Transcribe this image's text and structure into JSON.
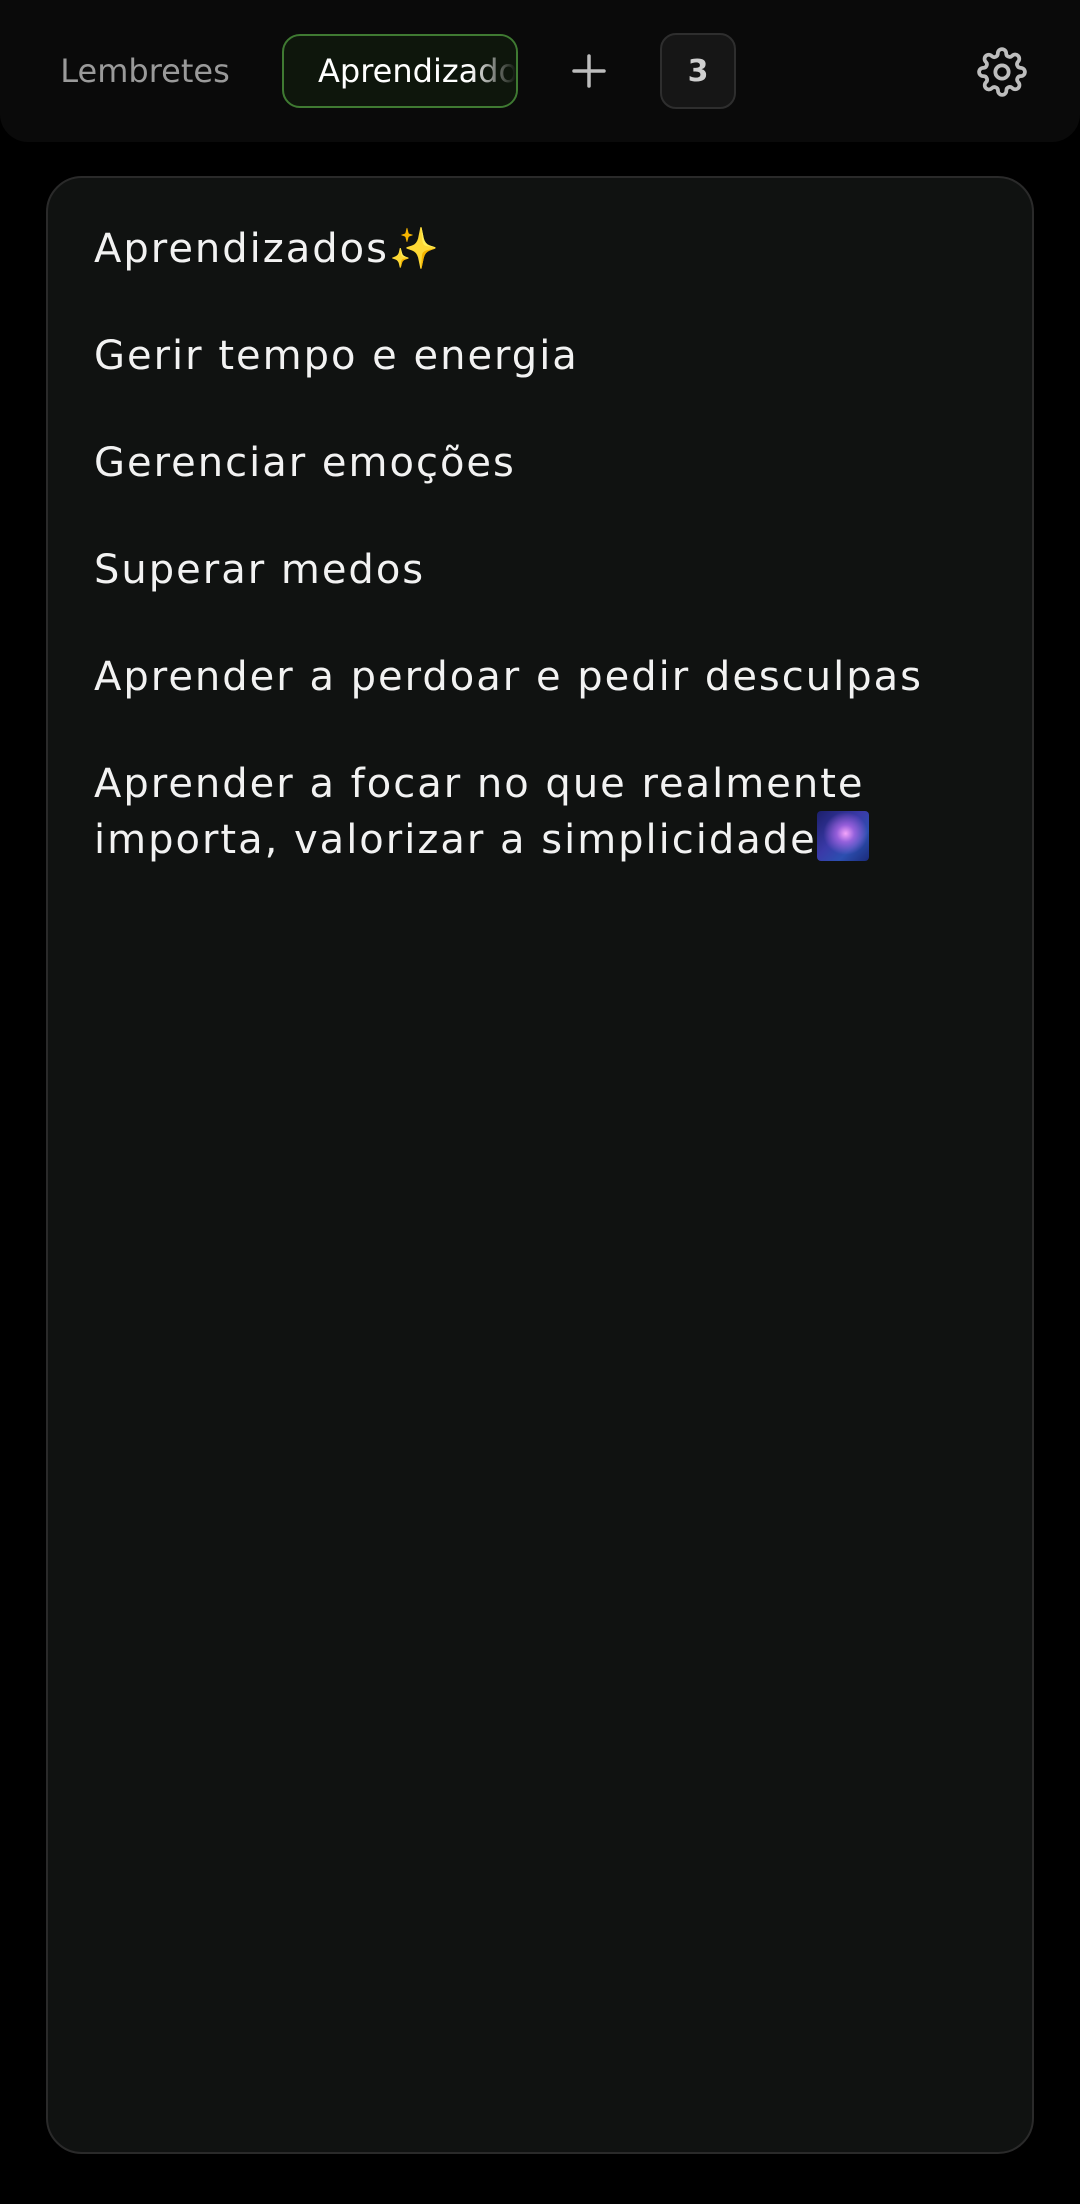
{
  "tabs": [
    {
      "label": "Lembretes",
      "active": false
    },
    {
      "label": "Aprendizados",
      "active": true
    }
  ],
  "toolbar": {
    "add_icon": "plus-icon",
    "count_label": "3",
    "settings_icon": "gear-icon"
  },
  "note": {
    "lines": [
      "Aprendizados",
      "Gerir tempo e energia",
      "Gerenciar emoções",
      "Superar medos",
      "Aprender a perdoar e pedir desculpas",
      "Aprender a focar no que realmente",
      "importa, valorizar a simplicidade"
    ],
    "title_emoji": "✨",
    "last_line_emoji": "milky-way-emoji"
  },
  "colors": {
    "background": "#000000",
    "card": "#101211",
    "active_tab_border": "#3f7a32",
    "text": "#f2f2f2",
    "muted_text": "#9a9a9a"
  }
}
